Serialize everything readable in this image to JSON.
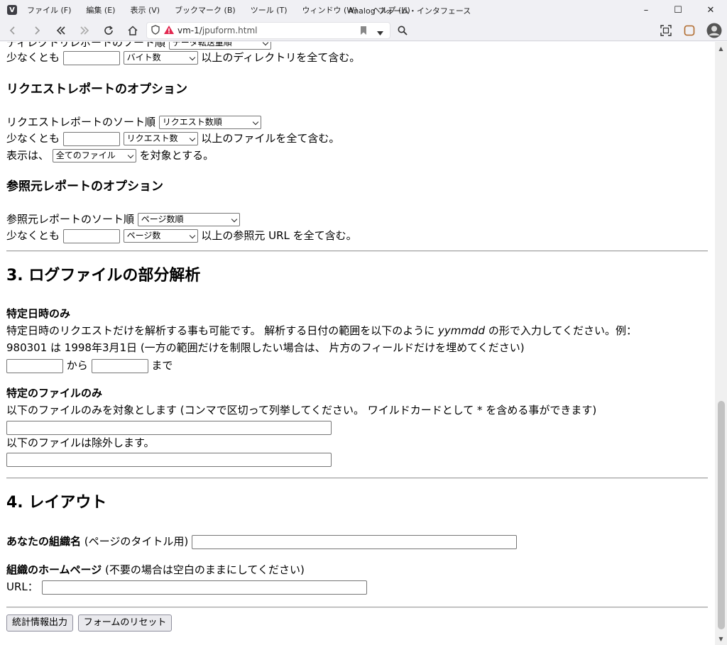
{
  "window": {
    "title": "Analog フォーム・インタフェース",
    "menu": [
      "ファイル (F)",
      "編集 (E)",
      "表示 (V)",
      "ブックマーク (B)",
      "ツール (T)",
      "ウィンドウ (W)",
      "ヘルプ (H)"
    ],
    "controls": {
      "minimize": "–",
      "maximize": "☐",
      "close": "✕"
    }
  },
  "nav": {
    "url_host": "vm-1/",
    "url_path": "jpuform.html"
  },
  "dir_report": {
    "partial_line": "ディレクトリレポートのソート順",
    "partial_select": "データ転送量順",
    "min_prefix": "少なくとも",
    "min_select": "バイト数",
    "min_suffix": "以上のディレクトリを全て含む。"
  },
  "request_report": {
    "heading": "リクエストレポートのオプション",
    "sort_label": "リクエストレポートのソート順",
    "sort_select": "リクエスト数順",
    "min_prefix": "少なくとも",
    "min_select": "リクエスト数",
    "min_suffix": "以上のファイルを全て含む。",
    "show_prefix": "表示は、",
    "show_select": "全てのファイル",
    "show_suffix": "を対象とする。"
  },
  "referrer_report": {
    "heading": "参照元レポートのオプション",
    "sort_label": "参照元レポートのソート順",
    "sort_select": "ページ数順",
    "min_prefix": "少なくとも",
    "min_select": "ページ数",
    "min_suffix": "以上の参照元 URL を全て含む。"
  },
  "partial": {
    "heading": "3. ログファイルの部分解析",
    "date_heading": "特定日時のみ",
    "date_desc_1a": "特定日時のリクエストだけを解析する事も可能です。 解析する日付の範囲を以下のように ",
    "date_desc_1b": "yymmdd",
    "date_desc_1c": " の形で入力してください。例：",
    "date_desc_2": "980301 は 1998年3月1日 (一方の範囲だけを制限したい場合は、 片方のフィールドだけを埋めてください)",
    "from_label": "から",
    "to_label": "まで",
    "file_heading": "特定のファイルのみ",
    "file_include_desc": "以下のファイルのみを対象とします (コンマで区切って列挙してください。 ワイルドカードとして * を含める事ができます)",
    "file_exclude_desc": "以下のファイルは除外します。"
  },
  "layout": {
    "heading": "4. レイアウト",
    "org_label_bold": "あなたの組織名",
    "org_label_rest": " (ページのタイトル用)",
    "home_label_bold": "組織のホームページ",
    "home_label_rest": " (不要の場合は空白のままにしてください)",
    "url_label": "URL："
  },
  "buttons": {
    "submit": "統計情報出力",
    "reset": "フォームのリセット"
  }
}
